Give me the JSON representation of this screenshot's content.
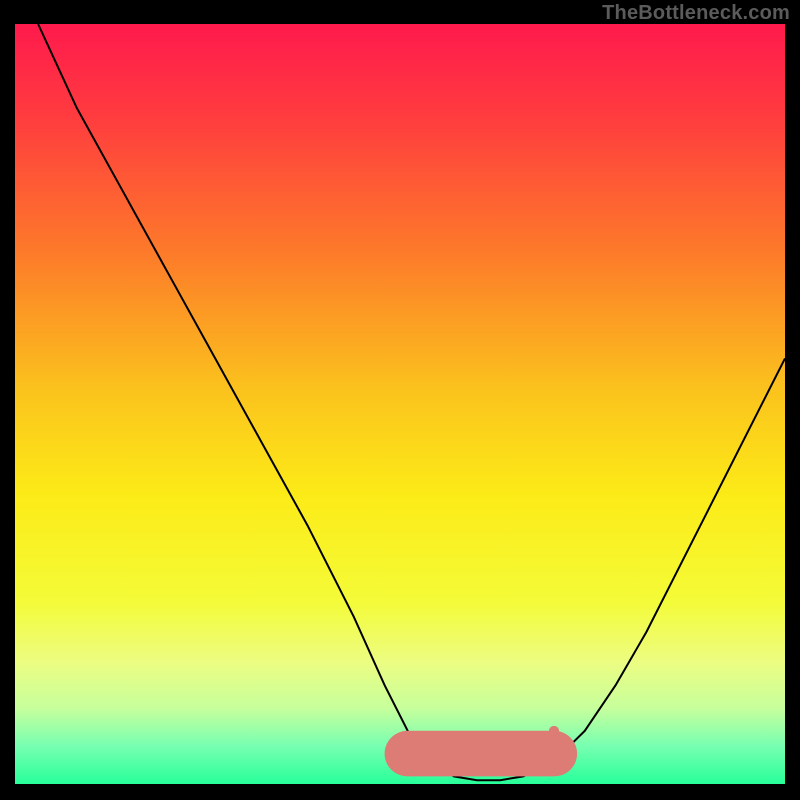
{
  "watermark": "TheBottleneck.com",
  "chart_data": {
    "type": "line",
    "title": "",
    "xlabel": "",
    "ylabel": "",
    "xlim": [
      0,
      100
    ],
    "ylim": [
      0,
      100
    ],
    "background_gradient": {
      "stops": [
        {
          "pos": 0.0,
          "color": "#ff1a4d"
        },
        {
          "pos": 0.12,
          "color": "#ff3b3f"
        },
        {
          "pos": 0.3,
          "color": "#fd7a2a"
        },
        {
          "pos": 0.48,
          "color": "#fbc21d"
        },
        {
          "pos": 0.62,
          "color": "#fceb17"
        },
        {
          "pos": 0.76,
          "color": "#f4fb38"
        },
        {
          "pos": 0.84,
          "color": "#ecfd82"
        },
        {
          "pos": 0.9,
          "color": "#c7ff9c"
        },
        {
          "pos": 0.95,
          "color": "#77ffb1"
        },
        {
          "pos": 1.0,
          "color": "#27ff9a"
        }
      ]
    },
    "curve": {
      "_note": "y is bottleneck % (100=top/red, 0=bottom/green). Curve is the black bottleneck line.",
      "x": [
        3,
        8,
        14,
        20,
        26,
        32,
        38,
        44,
        48,
        51,
        54,
        57,
        60,
        63,
        66,
        70,
        74,
        78,
        82,
        86,
        90,
        94,
        98,
        100
      ],
      "y": [
        100,
        89,
        78,
        67,
        56,
        45,
        34,
        22,
        13,
        7,
        3,
        1,
        0.5,
        0.5,
        1,
        3,
        7,
        13,
        20,
        28,
        36,
        44,
        52,
        56
      ]
    },
    "best_fit_band": {
      "x_range": [
        51,
        70
      ],
      "y": 4,
      "thickness": 6,
      "color": "#dd7b75"
    },
    "marker": {
      "x": 70,
      "y": 7,
      "r": 5,
      "color": "#dd7b75"
    }
  }
}
